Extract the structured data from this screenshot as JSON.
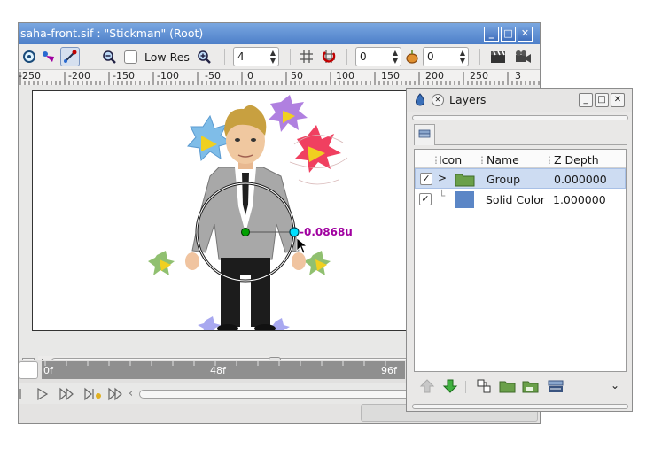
{
  "main_window": {
    "title": "saha-front.sif : \"Stickman\" (Root)",
    "buttons": {
      "minimize": "_",
      "maximize": "□",
      "close": "✕"
    }
  },
  "toolbar": {
    "low_res_label": "Low Res",
    "low_res_checked": false,
    "quality_value": "4",
    "onion_past_value": "0",
    "onion_future_value": "0"
  },
  "ruler": {
    "labels": [
      "-250",
      "-200",
      "-150",
      "-100",
      "-50",
      "0",
      "50",
      "100",
      "150",
      "200",
      "250",
      "3"
    ]
  },
  "canvas": {
    "readout": "-0.0868u"
  },
  "timeline": {
    "labels": [
      "0f",
      "48f",
      "96f"
    ]
  },
  "layers_panel": {
    "title": "Layers",
    "columns": {
      "icon": "Icon",
      "name": "Name",
      "zdepth": "Z Depth"
    },
    "rows": [
      {
        "name": "Group",
        "zdepth": "0.000000",
        "checked": true,
        "selected": true,
        "icon": "folder-icon",
        "expander": ">"
      },
      {
        "name": "Solid Color",
        "zdepth": "1.000000",
        "checked": true,
        "selected": false,
        "icon": "solid-color-icon",
        "expander": ""
      }
    ]
  },
  "colors": {
    "titlebar": "#5a8bd2",
    "selected_row": "#cddcf2",
    "folder": "#6aa04a",
    "solid_color": "#5b86c6",
    "readout": "#a000a0",
    "duck_outer": "#00e0ff",
    "duck_origin": "#00a000"
  }
}
